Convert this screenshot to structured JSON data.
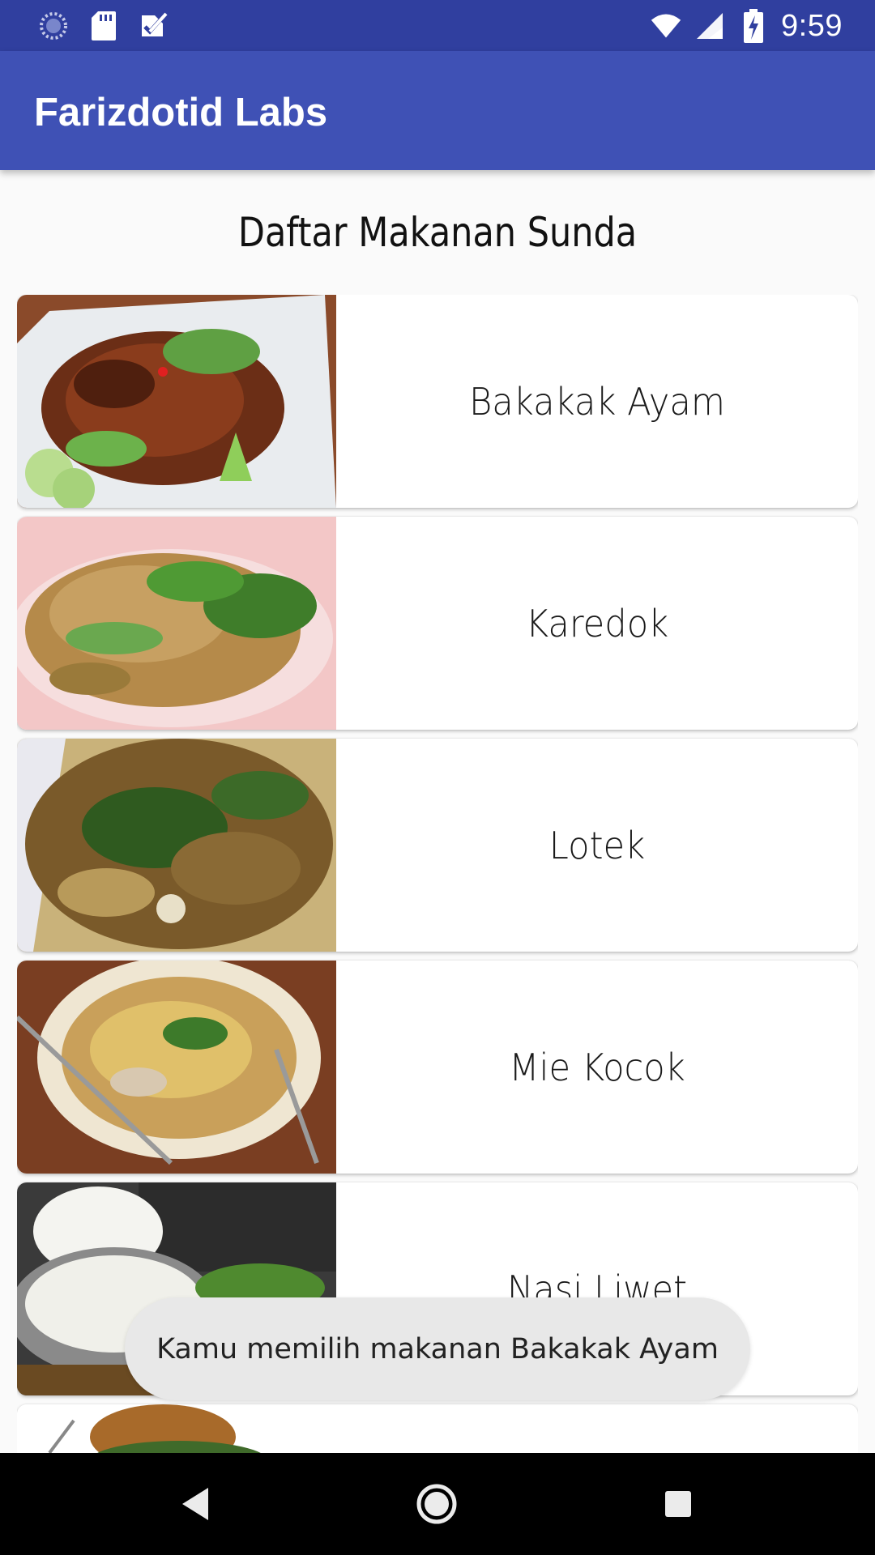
{
  "status_bar": {
    "time": "9:59",
    "left_icons": [
      "loading-circle-icon",
      "sd-card-icon",
      "checklist-icon"
    ],
    "right_icons": [
      "wifi-icon",
      "signal-icon",
      "battery-charging-icon"
    ]
  },
  "app_bar": {
    "title": "Farizdotid Labs",
    "color": "#3f51b5",
    "status_color": "#303f9f"
  },
  "page": {
    "heading": "Daftar Makanan Sunda"
  },
  "foods": [
    {
      "name": "Bakakak Ayam",
      "image": "grilled-chicken-photo"
    },
    {
      "name": "Karedok",
      "image": "vegetable-salad-photo"
    },
    {
      "name": "Lotek",
      "image": "peanut-sauce-vegetables-photo"
    },
    {
      "name": "Mie Kocok",
      "image": "noodle-soup-photo"
    },
    {
      "name": "Nasi Liwet",
      "image": "rice-pot-photo"
    },
    {
      "name": "",
      "image": "partially-visible-photo"
    }
  ],
  "toast": {
    "message": "Kamu memilih makanan Bakakak Ayam"
  },
  "nav_bar": {
    "buttons": [
      "back-icon",
      "home-icon",
      "recents-icon"
    ]
  }
}
